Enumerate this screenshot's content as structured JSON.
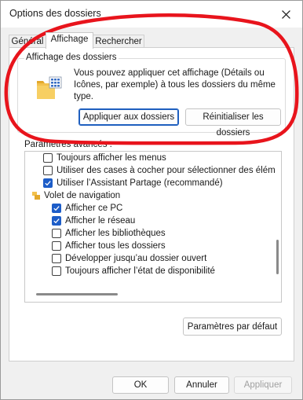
{
  "window": {
    "title": "Options des dossiers"
  },
  "tabs": [
    {
      "label": "Général"
    },
    {
      "label": "Affichage"
    },
    {
      "label": "Rechercher"
    }
  ],
  "folder_view": {
    "title": "Affichage des dossiers",
    "description": "Vous pouvez appliquer cet affichage (Détails ou Icônes, par exemple) à tous les dossiers du même type.",
    "apply_label": "Appliquer aux dossiers",
    "reset_label": "Réinitialiser les dossiers"
  },
  "advanced": {
    "label": "Paramètres avancés :",
    "items": [
      {
        "label": "Toujours afficher les menus",
        "checked": false
      },
      {
        "label": "Utiliser des cases à cocher pour sélectionner des élément",
        "checked": false
      },
      {
        "label": "Utiliser l’Assistant Partage (recommandé)",
        "checked": true
      },
      {
        "label": "Volet de navigation",
        "is_group": true
      },
      {
        "label": "Afficher ce PC",
        "checked": true
      },
      {
        "label": "Afficher le réseau",
        "checked": true
      },
      {
        "label": "Afficher les bibliothèques",
        "checked": false
      },
      {
        "label": "Afficher tous les dossiers",
        "checked": false
      },
      {
        "label": "Développer jusqu’au dossier ouvert",
        "checked": false
      },
      {
        "label": "Toujours afficher l’état de disponibilité",
        "checked": false
      }
    ],
    "defaults_label": "Paramètres par défaut"
  },
  "footer": {
    "ok_label": "OK",
    "cancel_label": "Annuler",
    "apply_label": "Appliquer"
  },
  "colors": {
    "accent": "#1d5dc8",
    "annotation": "#e8141c"
  },
  "icons": {
    "close": "close-icon",
    "folder": "folder-view-icon",
    "checkmark": "checkmark-icon",
    "nav_group": "navigation-pane-icon"
  }
}
